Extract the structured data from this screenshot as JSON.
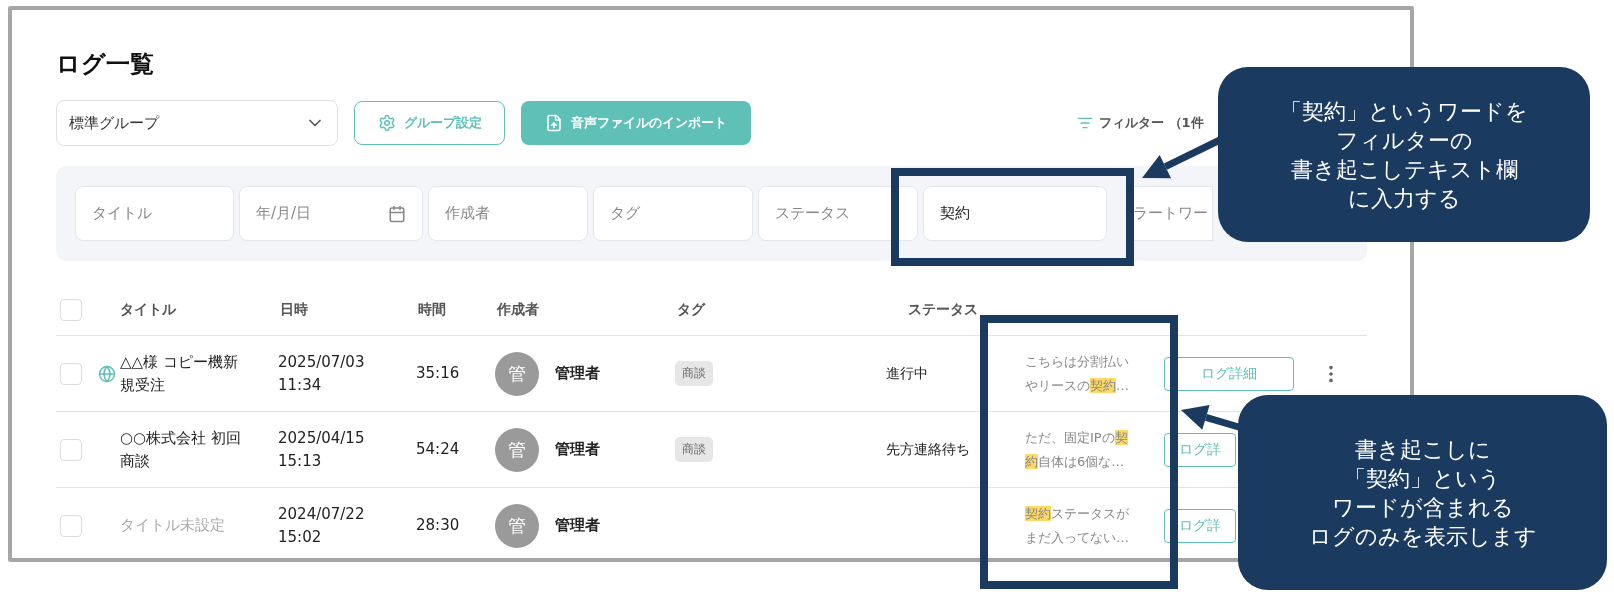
{
  "page_title": "ログ一覧",
  "toolbar": {
    "group_select": {
      "value": "標準グループ"
    },
    "group_settings_button": "グループ設定",
    "import_button": "音声ファイルのインポート",
    "filter_toggle": "フィルター （1件"
  },
  "filters": [
    {
      "kind": "text",
      "placeholder": "タイトル"
    },
    {
      "kind": "date",
      "placeholder": "年/月/日"
    },
    {
      "kind": "text",
      "placeholder": "作成者"
    },
    {
      "kind": "text",
      "placeholder": "タグ"
    },
    {
      "kind": "text",
      "placeholder": "ステータス"
    },
    {
      "kind": "text",
      "value": "契約"
    },
    {
      "kind": "text",
      "placeholder": "ラートワー"
    }
  ],
  "table": {
    "select_all_checked": false,
    "columns": [
      "タイトル",
      "日時",
      "時間",
      "作成者",
      "タグ",
      "ステータス"
    ],
    "rows": [
      {
        "checked": false,
        "globe": true,
        "untitled": false,
        "title": "△△様 コピー機新規受注",
        "date": "2025/07/03",
        "time": "11:34",
        "duration": "35:16",
        "avatar": "管",
        "author": "管理者",
        "tags": [
          "商談"
        ],
        "status": "進行中",
        "transcript": [
          {
            "text": "こちらは分割払いやリースの",
            "highlighted": false
          },
          {
            "text": "契約",
            "highlighted": true
          },
          {
            "text": "…",
            "highlighted": false
          }
        ],
        "detail_button": "ログ詳細",
        "menu_button": true
      },
      {
        "checked": false,
        "globe": false,
        "untitled": false,
        "title": "○○株式会社 初回商談",
        "date": "2025/04/15",
        "time": "15:13",
        "duration": "54:24",
        "avatar": "管",
        "author": "管理者",
        "tags": [
          "商談"
        ],
        "status": "先方連絡待ち",
        "transcript": [
          {
            "text": "ただ、固定IPの",
            "highlighted": false
          },
          {
            "text": "契約",
            "highlighted": true
          },
          {
            "text": "自体は6個な…",
            "highlighted": false
          }
        ],
        "detail_button": "ログ詳",
        "menu_button": false
      },
      {
        "checked": false,
        "globe": false,
        "untitled": true,
        "title": "タイトル未設定",
        "date": "2024/07/22",
        "time": "15:02",
        "duration": "28:30",
        "avatar": "管",
        "author": "管理者",
        "transcript": [
          {
            "text": "契約",
            "highlighted": true
          },
          {
            "text": "ステータスがまだ入ってない…",
            "highlighted": false
          }
        ],
        "detail_button": "ログ詳",
        "menu_button": false
      }
    ]
  },
  "annotations": [
    {
      "lines": [
        "「契約」というワードを",
        "フィルターの",
        "書き起こしテキスト欄",
        "に入力する"
      ]
    },
    {
      "lines": [
        "書き起こしに",
        "「契約」という",
        "ワードが含まれる",
        "ログのみを表示します"
      ]
    }
  ]
}
